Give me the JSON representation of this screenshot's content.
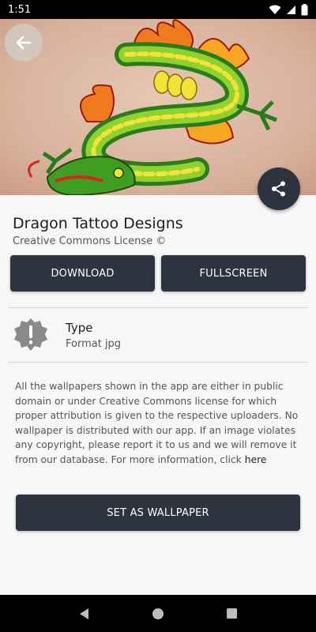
{
  "status_bar": {
    "time": "1:51",
    "icons": [
      "wifi-icon",
      "cell-signal-icon",
      "battery-icon"
    ]
  },
  "hero": {
    "image_alt": "dragon tattoo wallpaper",
    "back_icon": "arrow-left-icon",
    "share_icon": "share-icon"
  },
  "wallpaper": {
    "title": "Dragon Tattoo Designs",
    "license": "Creative Commons License ©"
  },
  "actions": {
    "download_label": "DOWNLOAD",
    "fullscreen_label": "FULLSCREEN",
    "set_wallpaper_label": "SET AS WALLPAPER"
  },
  "info": {
    "type_label": "Type",
    "type_value": "Format jpg",
    "type_icon": "alert-badge-icon"
  },
  "disclaimer": {
    "text": "All the wallpapers shown in the app are either in public domain or under Creative Commons license for which proper attribution is given to the respective uploaders. No wallpaper is distributed with our app. If an image violates any copyright, please report it to us and we will remove it from our database. For more information, click",
    "link_label": "here"
  },
  "colors": {
    "button_bg": "#2d3440",
    "page_bg": "#f7f7f7",
    "status_bar": "#000000"
  },
  "nav_bar": {
    "icons": [
      "back-triangle-icon",
      "home-circle-icon",
      "recents-square-icon"
    ]
  }
}
